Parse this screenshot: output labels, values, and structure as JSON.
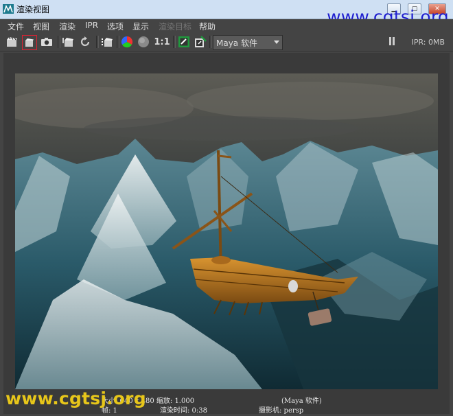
{
  "window": {
    "title": "渲染视图"
  },
  "watermark": "www.cgtsj.org",
  "menu": [
    "文件",
    "视图",
    "渲染",
    "IPR",
    "选项",
    "显示",
    "渲染目标",
    "帮助"
  ],
  "menu_disabled_index": 6,
  "toolbar": {
    "renderer_select": "Maya 软件",
    "ipr_status": "IPR: 0MB",
    "ratio_label": "1:1",
    "icons": [
      "render-frame-icon",
      "render-region-icon",
      "snapshot-icon",
      "ipr-render-icon",
      "refresh-icon",
      "render-sequence-icon",
      "rgb-channel-icon",
      "alpha-channel-icon",
      "ratio-one-to-one-icon",
      "keep-image-icon",
      "remove-image-icon"
    ]
  },
  "render_info": {
    "size": "大小: 640 x 480 缩放: 1.000",
    "renderer": "(Maya 软件)",
    "frame": "帧: 1",
    "render_time": "渲染时间: 0:38",
    "camera": "摄影机: persp"
  },
  "colors": {
    "sky": "#4a4c48",
    "water_dark": "#1d3f4c",
    "foam": "#dfe6e8",
    "ship": "#b9761c"
  }
}
